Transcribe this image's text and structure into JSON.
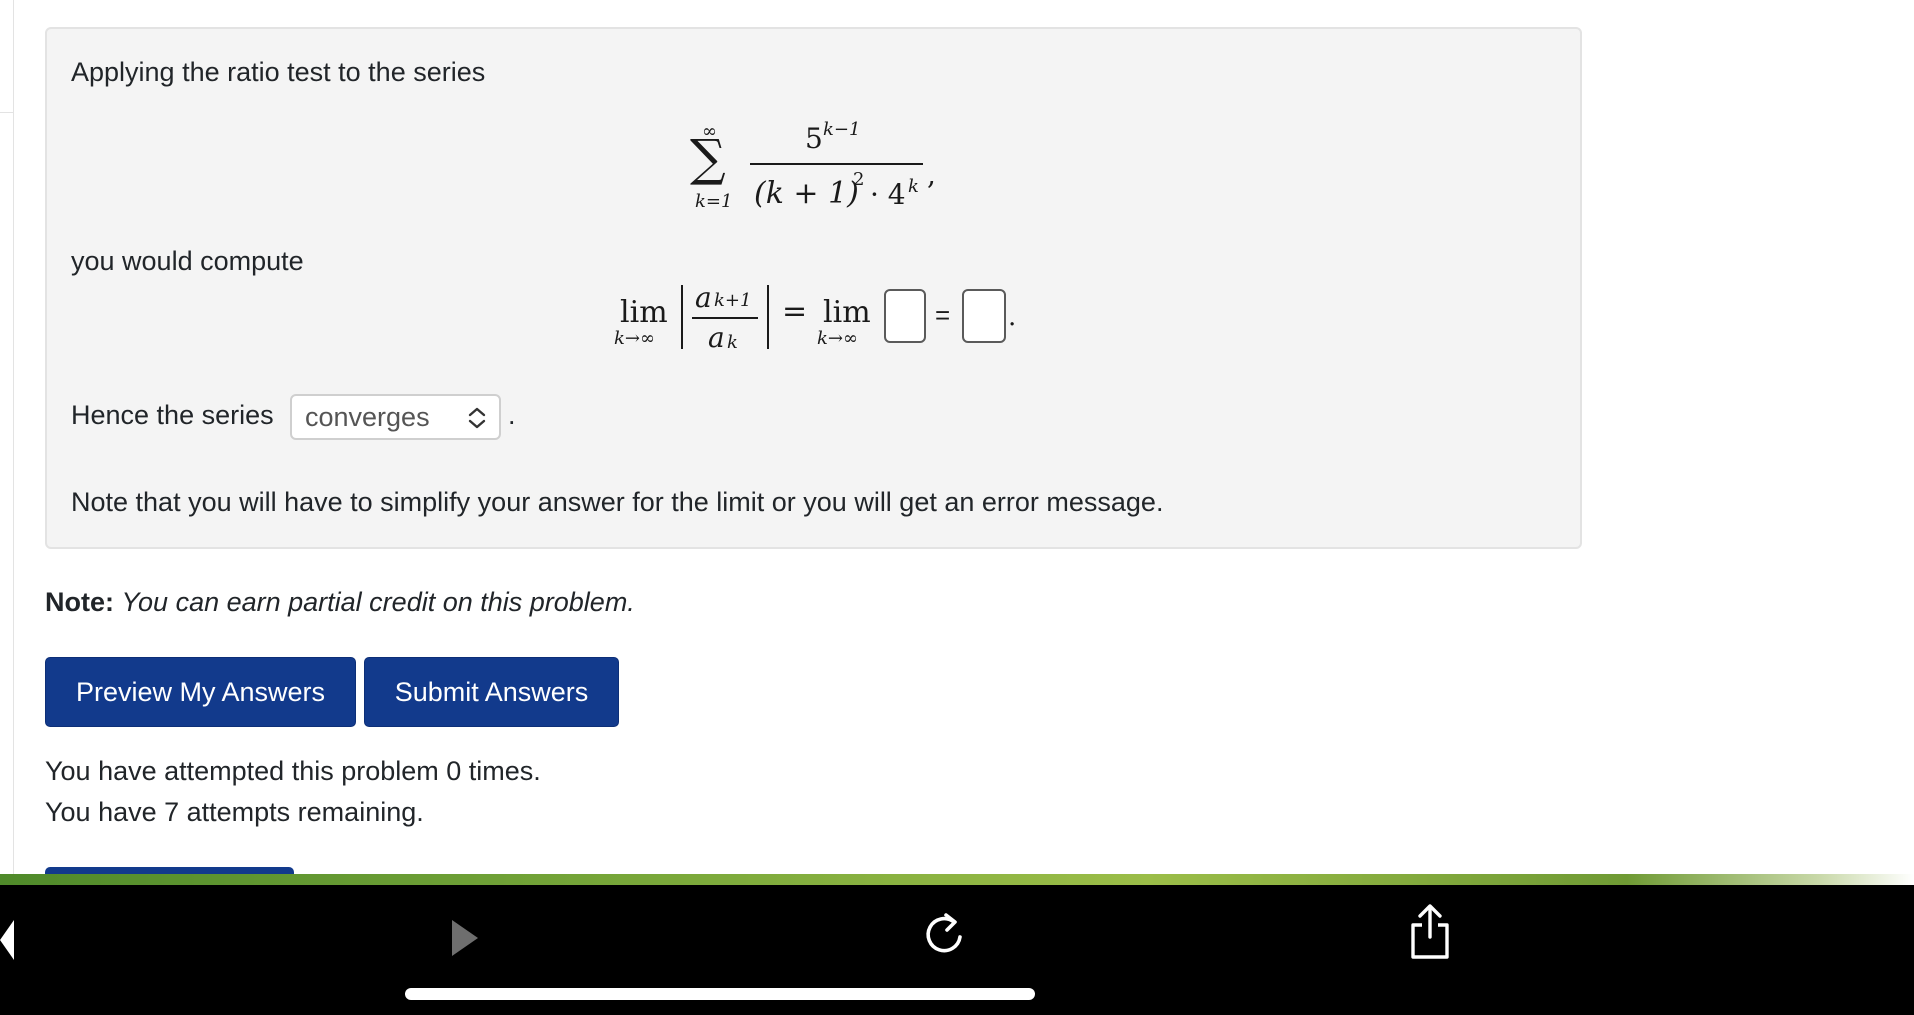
{
  "problem": {
    "intro": "Applying the ratio test to the series",
    "compute_text": "you would compute",
    "hence_text": "Hence the series",
    "period": ".",
    "note_text": "Note that you will have to simplify your answer for the limit or you will get an error message.",
    "series": {
      "sum_upper": "∞",
      "sum_lower": "k=1",
      "sigma": "∑",
      "numerator_base": "5",
      "numerator_exp": "k−1",
      "den_open": "(k + 1)",
      "den_sq": "2",
      "den_dot": "· 4",
      "den_exp": "k",
      "trailing": ","
    },
    "limit": {
      "lim": "lim",
      "lim_sub": "k→∞",
      "num": "a",
      "num_sub": "k+1",
      "den": "a",
      "den_sub": "k",
      "equals": "=",
      "lim2": "lim",
      "lim2_sub": "k→∞",
      "box_equals": "=",
      "end": "."
    },
    "select": {
      "value": "converges"
    }
  },
  "note": {
    "label": "Note:",
    "text": "You can earn partial credit on this problem."
  },
  "buttons": {
    "preview": "Preview My Answers",
    "submit": "Submit Answers"
  },
  "status": {
    "attempted": "You have attempted this problem 0 times.",
    "remaining": "You have 7 attempts remaining."
  },
  "colors": {
    "button_bg": "#123a8c",
    "panel_bg": "#f4f4f4",
    "toolbar_bg": "#000000"
  },
  "toolbar": {
    "icons": [
      "back-icon",
      "forward-icon",
      "reload-icon",
      "share-icon"
    ]
  }
}
